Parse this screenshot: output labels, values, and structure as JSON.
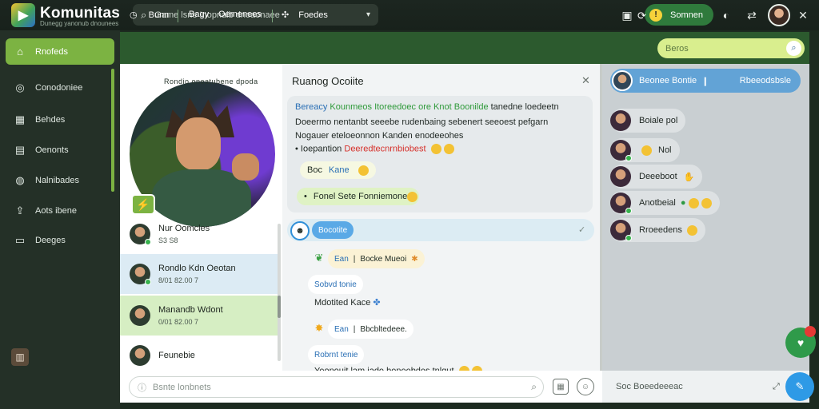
{
  "app": {
    "brand": "Komunitas",
    "brand_sub": "Dunegg yanonub dnounees",
    "search_placeholder": "Game lsne Inopnaib dnoaonaee",
    "premium_label": "Somnen",
    "premium_badge": "!"
  },
  "sidebar": {
    "items": [
      {
        "label": "Rnofeds",
        "icon": "home-icon"
      },
      {
        "label": "Conodoniee",
        "icon": "location-pin-icon"
      },
      {
        "label": "Behdes",
        "icon": "calendar-icon"
      },
      {
        "label": "Oenonts",
        "icon": "image-icon"
      },
      {
        "label": "Nalnibades",
        "icon": "chat-bubble-icon"
      },
      {
        "label": "Aots ibene",
        "icon": "upload-icon"
      },
      {
        "label": "Deeges",
        "icon": "display-icon"
      }
    ]
  },
  "toolbar": {
    "items": [
      {
        "label": "Bunn",
        "icon": "clock-icon"
      },
      {
        "label": "Bagy",
        "icon": ""
      },
      {
        "label": "Oemenees",
        "icon": ""
      },
      {
        "label": "Foedes",
        "icon": "grid-icon"
      }
    ],
    "search_placeholder": "Beros"
  },
  "profile": {
    "title": "Rondio oneatubene dpoda",
    "contacts": [
      {
        "name": "Nur Oomcles",
        "sub": "S3 S8"
      },
      {
        "name": "Rondlo Kdn Oeotan",
        "sub": "8/01 82.00 7"
      },
      {
        "name": "Manandb Wdont",
        "sub": "0/01 82.00 7"
      },
      {
        "name": "Feunebie",
        "sub": ""
      }
    ]
  },
  "chat": {
    "title": "Ruanog Ocoiite",
    "post": {
      "line1_blue": "Bereacy",
      "line1_green": "Kounmeos Itoreedoec ore Knot Boonilde",
      "line1_rest": "tanedne loedeetn",
      "line2_a": "Doeermo nentanbt",
      "line2_b": "seeebe rudenbaing sebenert seeoest pefgarn",
      "line3": "Nogauer eteloeonnon Kanden enodeeohes",
      "line4_a": "Ioepantion",
      "line4_red": "Deeredtecnrnbiobest",
      "chip1_a": "Boc",
      "chip1_b": "Kane",
      "chip2": "Fonel Sete Fonniemones"
    },
    "thread_tag": "Bocotite",
    "messages": [
      {
        "author": "",
        "reply_label": "Ean",
        "reply_text": "Bocke Mueoi"
      },
      {
        "author": "Sobvd tonie",
        "text": "Mdotited Kace"
      },
      {
        "author": "",
        "reply_label": "Ean",
        "reply_text": "Bbcbltedeee."
      },
      {
        "author": "Robrnt tenie",
        "text": "Yeonouit lam jade beneebdes tnlgut"
      }
    ],
    "input_placeholder": "Bsnte lonbnets"
  },
  "room": {
    "name": "Beonee Bontie",
    "status": "Rbeeodsbsle",
    "members": [
      {
        "name": "Boiale pol"
      },
      {
        "name": "Nol"
      },
      {
        "name": "Deeeboot"
      },
      {
        "name": "Anotbeial"
      },
      {
        "name": "Rroeedens"
      }
    ],
    "input_placeholder": "Soc Boeedeeeac"
  },
  "colors": {
    "accent": "#7cb342",
    "toolbar": "#2c5a2e",
    "sidebar": "#243027",
    "room_pill": "#62a3d6",
    "highlight_red": "#d6312b"
  }
}
